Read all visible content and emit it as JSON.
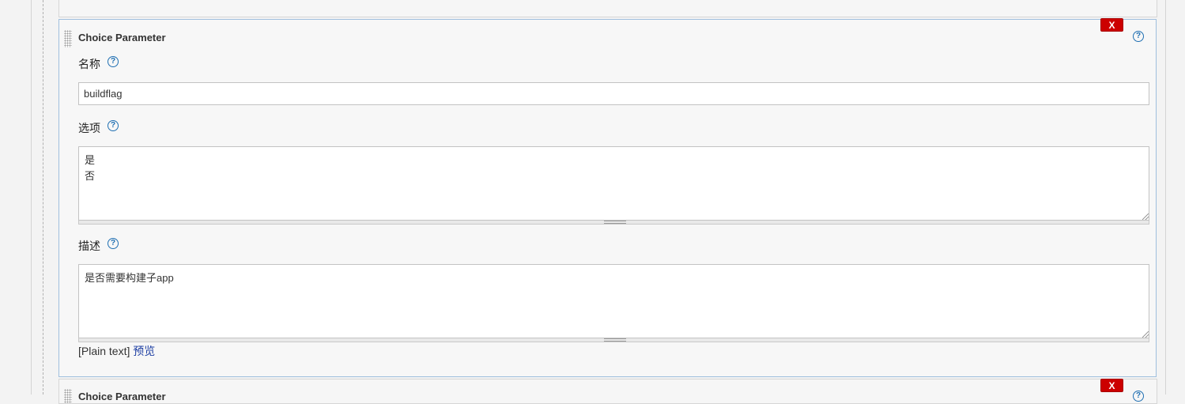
{
  "param_block": {
    "title": "Choice Parameter",
    "delete_label": "X",
    "help_glyph": "?",
    "name": {
      "label": "名称",
      "value": "buildflag"
    },
    "choices": {
      "label": "选项",
      "value": "是\n否"
    },
    "description": {
      "label": "描述",
      "value": "是否需要构建子app"
    },
    "format_note": "[Plain text]",
    "preview_label": "预览"
  },
  "next_block": {
    "title": "Choice Parameter",
    "delete_label": "X"
  },
  "colors": {
    "accent": "#1f6fb2",
    "delete_red": "#cc0000",
    "link": "#1e3fa3"
  },
  "icons": [
    "drag-handle-icon",
    "help-icon",
    "resize-corner-icon"
  ]
}
